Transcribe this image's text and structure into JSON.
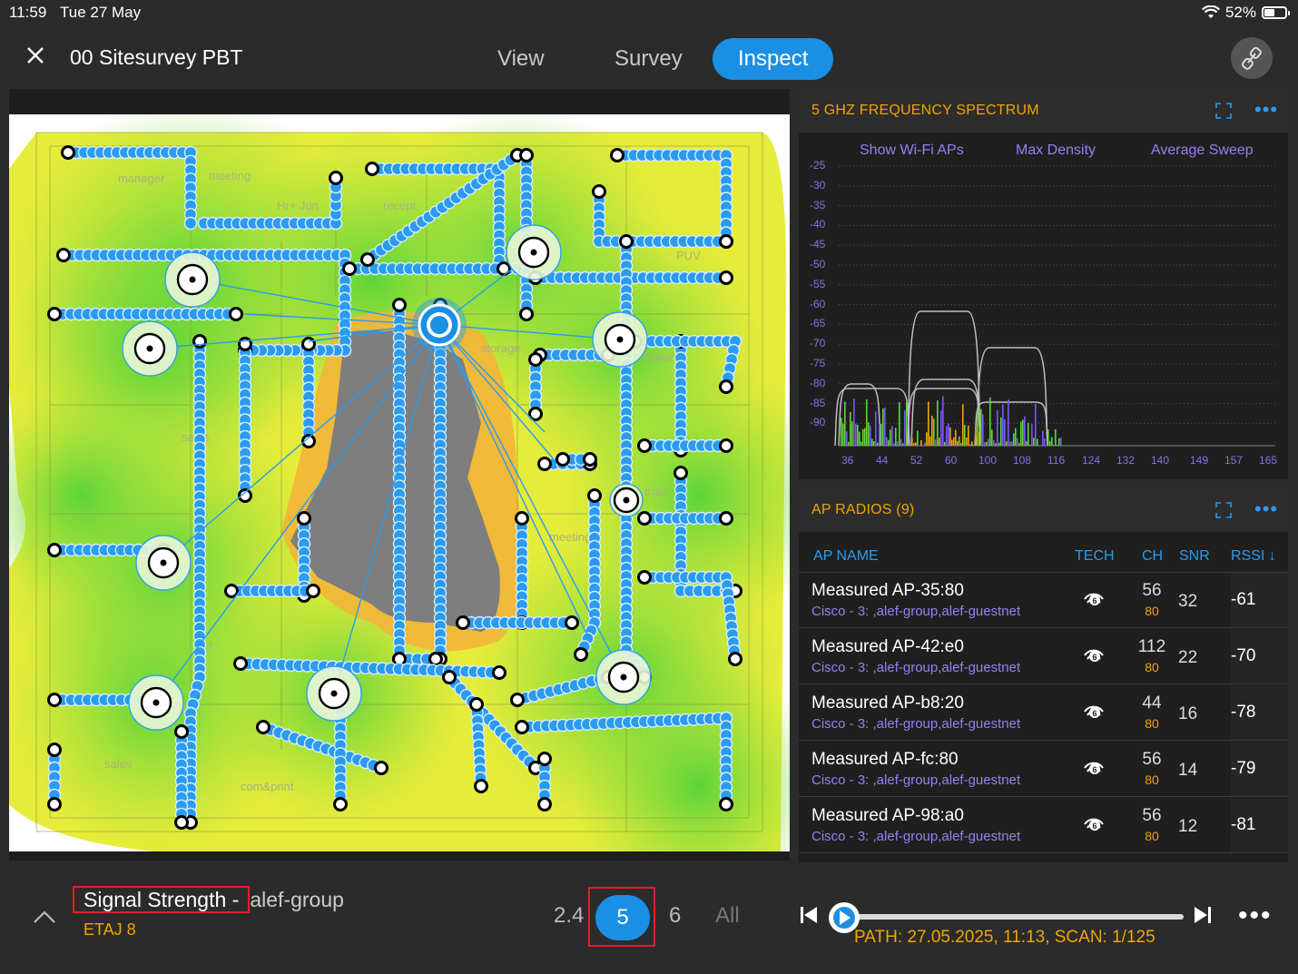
{
  "status": {
    "time": "11:59",
    "date": "Tue 27 May",
    "battery": "52%",
    "battery_level": 0.52
  },
  "header": {
    "title": "00 Sitesurvey PBT",
    "tabs": [
      {
        "label": "View",
        "active": false
      },
      {
        "label": "Survey",
        "active": false
      },
      {
        "label": "Inspect",
        "active": true
      }
    ],
    "icons": {
      "close": "close-icon",
      "right_button": "link-off-icon"
    }
  },
  "map": {
    "room_labels": [
      "manager",
      "meeting",
      "Hr+ Jun",
      "recept",
      "PUV",
      "storage",
      "training",
      "sales",
      "meeting",
      "train",
      "com&print",
      "sales",
      "inf"
    ]
  },
  "spectrum": {
    "title": "5 GHZ FREQUENCY SPECTRUM",
    "options": [
      "Show Wi-Fi APs",
      "Max Density",
      "Average Sweep"
    ],
    "y_ticks": [
      "-25",
      "-30",
      "-35",
      "-40",
      "-45",
      "-50",
      "-55",
      "-60",
      "-65",
      "-70",
      "-75",
      "-80",
      "-85",
      "-90"
    ],
    "x_ticks": [
      "36",
      "44",
      "52",
      "60",
      "100",
      "108",
      "116",
      "124",
      "132",
      "140",
      "149",
      "157",
      "165"
    ]
  },
  "ap_radios": {
    "title": "AP RADIOS (9)",
    "columns": {
      "name": "AP NAME",
      "tech": "TECH",
      "ch": "CH",
      "snr": "SNR",
      "rssi": "RSSI ↓"
    },
    "rows": [
      {
        "name": "Measured AP-35:80",
        "vendor": "Cisco - 3: ,alef-group,alef-guestnet",
        "ch": "56",
        "bw": "80",
        "snr": "32",
        "rssi": "-61"
      },
      {
        "name": "Measured AP-42:e0",
        "vendor": "Cisco - 3: ,alef-group,alef-guestnet",
        "ch": "112",
        "bw": "80",
        "snr": "22",
        "rssi": "-70"
      },
      {
        "name": "Measured AP-b8:20",
        "vendor": "Cisco - 3: ,alef-group,alef-guestnet",
        "ch": "44",
        "bw": "80",
        "snr": "16",
        "rssi": "-78"
      },
      {
        "name": "Measured AP-fc:80",
        "vendor": "Cisco - 3: ,alef-group,alef-guestnet",
        "ch": "56",
        "bw": "80",
        "snr": "14",
        "rssi": "-79"
      },
      {
        "name": "Measured AP-98:a0",
        "vendor": "Cisco - 3: ,alef-group,alef-guestnet",
        "ch": "56",
        "bw": "80",
        "snr": "12",
        "rssi": "-81"
      }
    ]
  },
  "bottom": {
    "metric": "Signal Strength",
    "separator": "-",
    "network": "alef-group",
    "floor": "ETAJ 8",
    "bands": [
      {
        "label": "2.4",
        "active": false
      },
      {
        "label": "5",
        "active": true
      },
      {
        "label": "6",
        "active": false
      },
      {
        "label": "All",
        "active": false
      }
    ],
    "path": "PATH: 27.05.2025, 11:13, SCAN: 1/125",
    "scan_progress": 0.008
  },
  "colors": {
    "accent": "#1a8fe3",
    "orange": "#f0a500",
    "purple": "#9b7ff0",
    "highlight": "#e0202a"
  }
}
